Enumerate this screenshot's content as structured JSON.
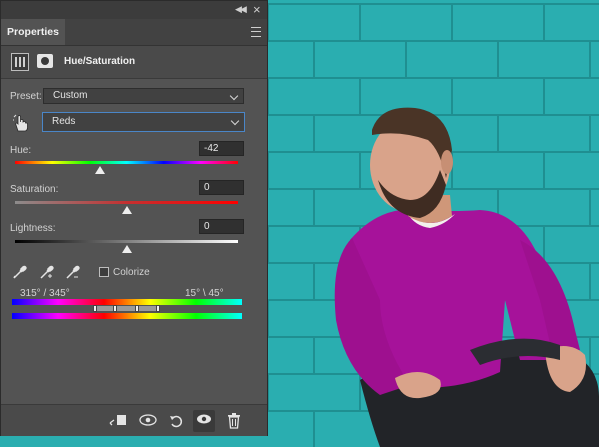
{
  "panel": {
    "tab_label": "Properties",
    "adjustment_title": "Hue/Saturation",
    "preset_label": "Preset:",
    "preset_value": "Custom",
    "channel_value": "Reds",
    "hue": {
      "label": "Hue:",
      "value": "-42",
      "level": 0.38
    },
    "saturation": {
      "label": "Saturation:",
      "value": "0",
      "level": 0.5
    },
    "lightness": {
      "label": "Lightness:",
      "value": "0",
      "level": 0.5
    },
    "colorize_label": "Colorize",
    "colorize_checked": false,
    "range_left": "315° / 345°",
    "range_right": "15° \\ 45°"
  },
  "icons": {
    "panel_menu": "hamburger-icon",
    "collapse": "double-chevron-icon",
    "close": "close-icon",
    "adjustment_layer": "hue-saturation-icon",
    "mask": "layer-mask-icon",
    "target_adjust": "hand-target-icon",
    "eyedroppers": [
      "eyedropper-icon",
      "eyedropper-add-icon",
      "eyedropper-subtract-icon"
    ],
    "bottom": [
      "clip-to-layer-icon",
      "view-previous-state-icon",
      "reset-icon",
      "visibility-icon",
      "delete-icon"
    ]
  },
  "colors": {
    "panel_bg": "#535353",
    "photo_wall": "#2aaeb0",
    "sweater": "#a6129a",
    "focus_border": "#4a86c8"
  }
}
